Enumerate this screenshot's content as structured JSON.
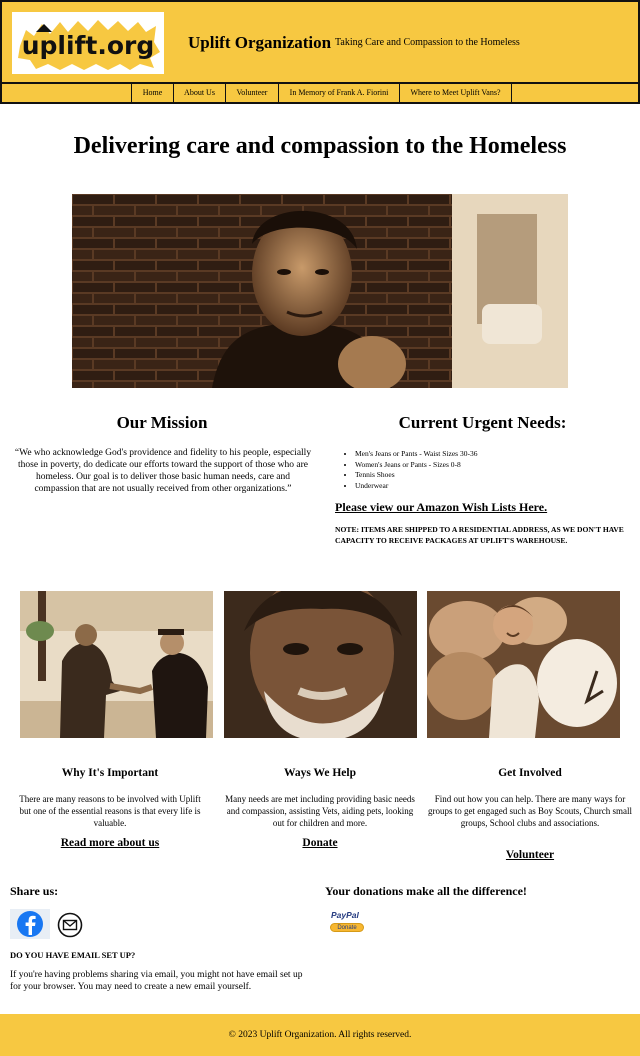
{
  "header": {
    "logo_text": "uplift.org",
    "brand": "Uplift Organization",
    "tagline": "Taking Care and Compassion to the Homeless",
    "accent_color": "#f7c841"
  },
  "nav": {
    "items": [
      {
        "label": "Home"
      },
      {
        "label": "About Us"
      },
      {
        "label": "Volunteer"
      },
      {
        "label": "In Memory of Frank A. Fiorini"
      },
      {
        "label": "Where to Meet Uplift Vans?"
      }
    ]
  },
  "hero": {
    "title": "Delivering care and compassion to the Homeless"
  },
  "mission": {
    "title": "Our Mission",
    "text": "“We who acknowledge God's providence and fidelity to his people, especially those in poverty, do dedicate our efforts toward the support of those who are homeless. Our goal is to deliver those basic human needs, care and compassion that are not usually received from other organizations.”"
  },
  "needs": {
    "title": "Current Urgent Needs:",
    "items": [
      "Men's Jeans or Pants - Waist Sizes 30-36",
      "Women's Jeans or Pants - Sizes 0-8",
      "Tennis Shoes",
      "Underwear"
    ],
    "wish_link": "Please view our Amazon Wish Lists Here.",
    "note": "NOTE: ITEMS ARE SHIPPED TO A RESIDENTIAL ADDRESS, AS WE DON'T HAVE CAPACITY TO RECEIVE PACKAGES AT UPLIFT'S WAREHOUSE."
  },
  "columns": [
    {
      "title": "Why It's Important",
      "text": "There are many reasons to be involved with Uplift but one of the essential reasons is that every life is valuable.",
      "link": "Read more about us"
    },
    {
      "title": "Ways We Help",
      "text": "Many needs are met including providing basic needs and compassion, assisting Vets, aiding pets, looking out for children and more.",
      "link": "Donate"
    },
    {
      "title": "Get Involved",
      "text": "Find out how you can help. There are many ways for groups to get engaged such as Boy Scouts, Church small groups, School clubs and associations.",
      "link": "Volunteer"
    }
  ],
  "share": {
    "title": "Share us:",
    "facebook_icon": "facebook-icon",
    "email_icon": "envelope-icon",
    "email_question": "DO YOU HAVE EMAIL SET UP?",
    "email_help": "If you're having problems sharing via email, you might not have email set up for your browser. You may need to create a new email yourself."
  },
  "donations": {
    "title": "Your donations make all the difference!",
    "paypal_label": "PayPal",
    "donate_label": "Donate"
  },
  "footer": {
    "copyright": "© 2023 Uplift Organization. All rights reserved."
  }
}
